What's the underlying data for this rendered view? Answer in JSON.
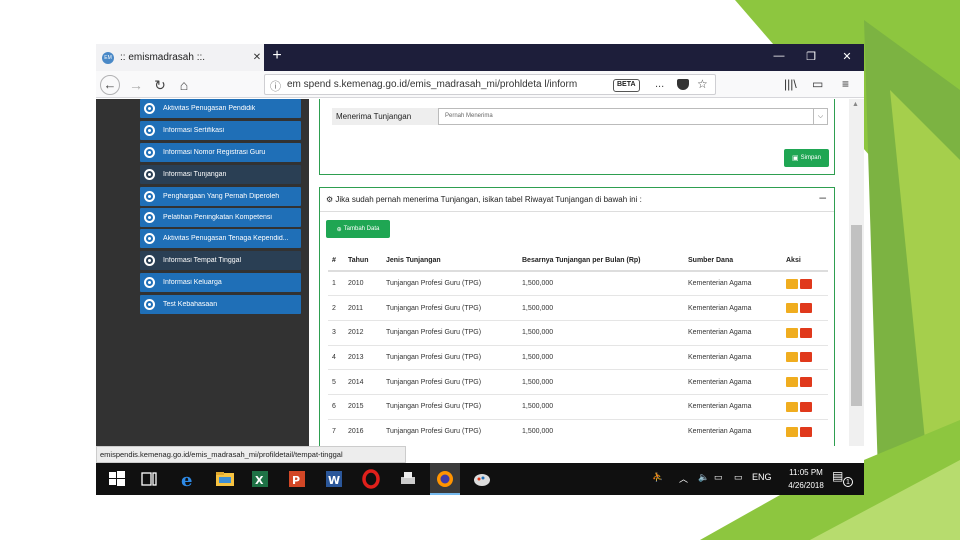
{
  "colors": {
    "slide_accent_green": "#8dc63f",
    "tabbar_bg": "#1d1e3a",
    "sidebar_bg": "#323232",
    "sidebar_item": "#1f6fb7",
    "sidebar_item_active": "#2a3f54",
    "panel_border": "#2e9e50",
    "button_green": "#1fa653",
    "edit_button": "#f0ad1f",
    "delete_button": "#e0391c",
    "taskbar_bg": "#101010"
  },
  "browser": {
    "tab_title": ":: emismadrasah ::.",
    "url": "em spend s.kemenag.go.id/emis_madrasah_mi/prohldeta l/inform",
    "reader_badge": "BETA",
    "more_icon": "...",
    "nav_icons": [
      "back-arrow-icon",
      "forward-arrow-icon",
      "reload-icon",
      "home-icon"
    ]
  },
  "sidebar": {
    "items": [
      {
        "label": "Aktivitas Penugasan Pendidik",
        "active": false
      },
      {
        "label": "Informasi Sertifikasi",
        "active": false
      },
      {
        "label": "Informasi Nomor Registrasi Guru",
        "active": false
      },
      {
        "label": "Informasi Tunjangan",
        "active": true
      },
      {
        "label": "Penghargaan Yang Pernah Diperoleh",
        "active": false
      },
      {
        "label": "Pelatihan Peningkatan Kompetensi",
        "active": false
      },
      {
        "label": "Aktivitas Penugasan Tenaga Kependid...",
        "active": false
      },
      {
        "label": "Informasi Tempat Tinggal",
        "active": true
      },
      {
        "label": "Informasi Keluarga",
        "active": false
      },
      {
        "label": "Test Kebahasaan",
        "active": false
      }
    ]
  },
  "form": {
    "label": "Menerima Tunjangan",
    "select_value": "Pernah Menerima",
    "save_button": "Simpan"
  },
  "riwayat": {
    "header": "Jika sudah pernah menerima Tunjangan, isikan tabel Riwayat Tunjangan di bawah ini :",
    "add_button": "Tambah Data",
    "columns": [
      "#",
      "Tahun",
      "Jenis Tunjangan",
      "Besarnya Tunjangan per Bulan (Rp)",
      "Sumber Dana",
      "Aksi"
    ],
    "rows": [
      {
        "no": "1",
        "tahun": "2010",
        "jenis": "Tunjangan Profesi Guru (TPG)",
        "besar": "1,500,000",
        "sumber": "Kementerian Agama"
      },
      {
        "no": "2",
        "tahun": "2011",
        "jenis": "Tunjangan Profesi Guru (TPG)",
        "besar": "1,500,000",
        "sumber": "Kementerian Agama"
      },
      {
        "no": "3",
        "tahun": "2012",
        "jenis": "Tunjangan Profesi Guru (TPG)",
        "besar": "1,500,000",
        "sumber": "Kementerian Agama"
      },
      {
        "no": "4",
        "tahun": "2013",
        "jenis": "Tunjangan Profesi Guru (TPG)",
        "besar": "1,500,000",
        "sumber": "Kementerian Agama"
      },
      {
        "no": "5",
        "tahun": "2014",
        "jenis": "Tunjangan Profesi Guru (TPG)",
        "besar": "1,500,000",
        "sumber": "Kementerian Agama"
      },
      {
        "no": "6",
        "tahun": "2015",
        "jenis": "Tunjangan Profesi Guru (TPG)",
        "besar": "1,500,000",
        "sumber": "Kementerian Agama"
      },
      {
        "no": "7",
        "tahun": "2016",
        "jenis": "Tunjangan Profesi Guru (TPG)",
        "besar": "1,500,000",
        "sumber": "Kementerian Agama"
      }
    ]
  },
  "statusbar": {
    "text": "emispendis.kemenag.go.id/emis_madrasah_mi/profildetail/tempat-tinggal"
  },
  "taskbar": {
    "language": "ENG",
    "time": "11:05 PM",
    "date": "4/26/2018",
    "notification_count": "1"
  }
}
